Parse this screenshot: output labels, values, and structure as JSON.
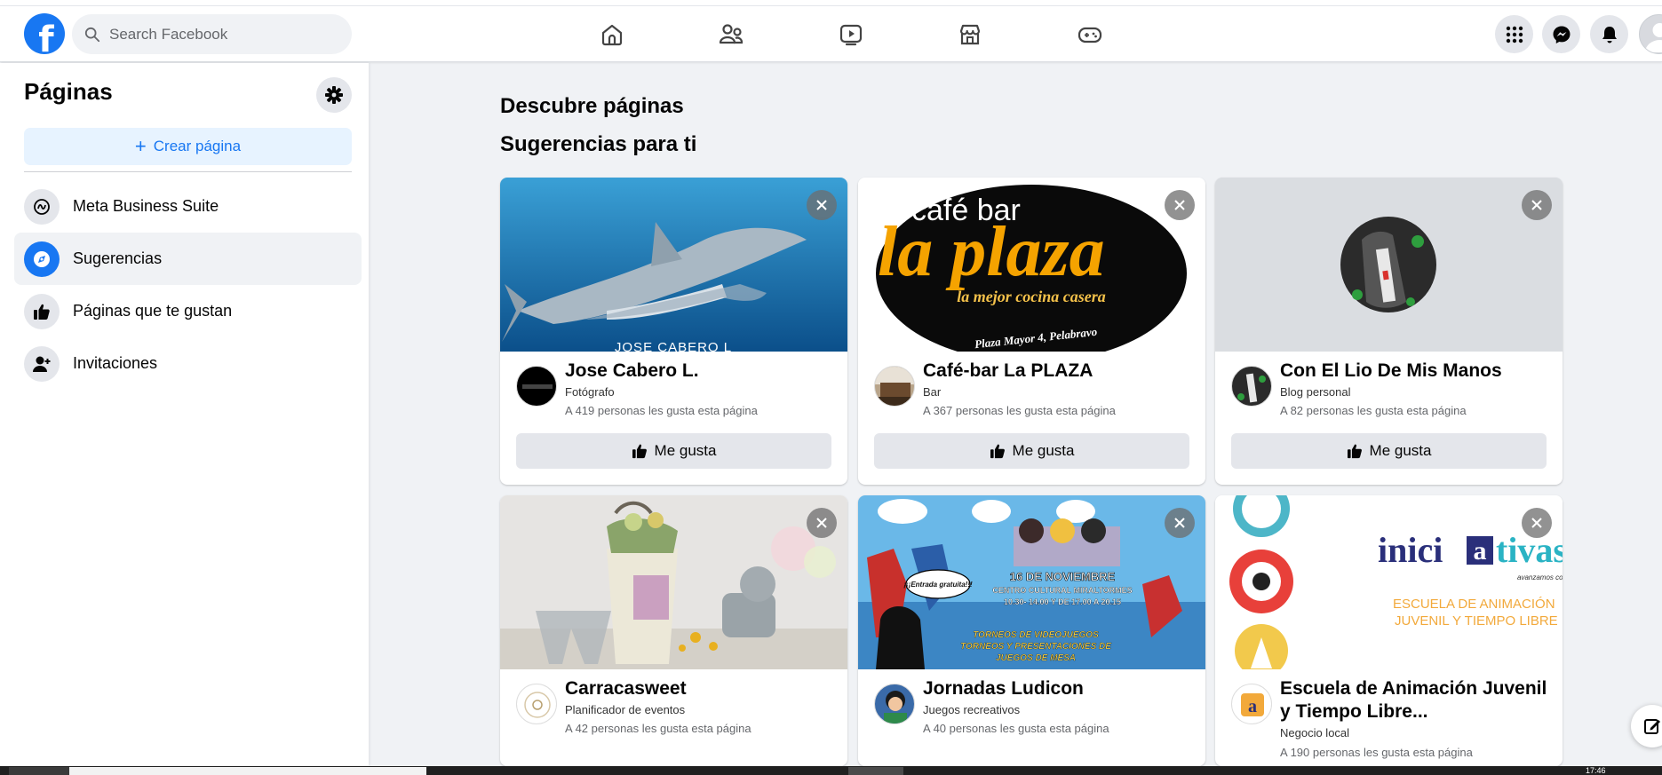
{
  "header": {
    "search_placeholder": "Search Facebook",
    "nav_icons": [
      "home-icon",
      "friends-icon",
      "watch-icon",
      "marketplace-icon",
      "gaming-icon"
    ],
    "right_icons": [
      "menu-grid-icon",
      "messenger-icon",
      "notifications-icon"
    ]
  },
  "sidebar": {
    "title": "Páginas",
    "create_label": "Crear página",
    "items": [
      {
        "label": "Meta Business Suite",
        "icon": "meta-business-icon"
      },
      {
        "label": "Sugerencias",
        "icon": "compass-icon"
      },
      {
        "label": "Páginas que te gustan",
        "icon": "thumbs-up-icon"
      },
      {
        "label": "Invitaciones",
        "icon": "person-add-icon"
      }
    ]
  },
  "main": {
    "discover_title": "Descubre páginas",
    "suggestions_title": "Sugerencias para ti",
    "like_label": "Me gusta",
    "cards": [
      {
        "name": "Jose Cabero L.",
        "category": "Fotógrafo",
        "likes": "A 419 personas les gusta esta página",
        "cover_text": "JOSE CABERO L"
      },
      {
        "name": "Café-bar La PLAZA",
        "category": "Bar",
        "likes": "A 367 personas les gusta esta página",
        "cover_line1": "café bar",
        "cover_line2": "la plaza",
        "cover_line3": "la mejor cocina casera",
        "cover_line4": "Plaza Mayor 4, Pelabravo"
      },
      {
        "name": "Con El Lio De Mis Manos",
        "category": "Blog personal",
        "likes": "A 82 personas les gusta esta página"
      },
      {
        "name": "Carracasweet",
        "category": "Planificador de eventos",
        "likes": "A 42 personas les gusta esta página"
      },
      {
        "name": "Jornadas Ludicon",
        "category": "Juegos recreativos",
        "likes": "A 40 personas les gusta esta página",
        "cover_line1": "16 DE NOVIEMBRE",
        "cover_line2": "CENTRO CULTURAL MIRALTORMES",
        "cover_line3": "10.30- 14.00 Y DE 17.00 A 20.15",
        "cover_line4": "¡¡¡Entrada gratuita!!!",
        "cover_line5": "TORNEOS DE VIDEOJUEGOS",
        "cover_line6": "TORNEOS Y PRESENTACIONES DE",
        "cover_line7": "JUEGOS DE MESA"
      },
      {
        "name": "Escuela de Animación Juvenil y Tiempo Libre...",
        "category": "Negocio local",
        "likes": "A 190 personas les gusta esta página",
        "cover_brand_a": "inici",
        "cover_brand_b": "a",
        "cover_brand_c": "tivas",
        "cover_slogan": "avanzamos con",
        "cover_line1": "ESCUELA DE ANIMACIÓN",
        "cover_line2": "JUVENIL Y TIEMPO LIBRE"
      }
    ]
  },
  "taskbar": {
    "time": "17:46"
  },
  "colors": {
    "brand": "#1877f2",
    "background": "#f0f2f5",
    "button": "#e4e6eb"
  }
}
